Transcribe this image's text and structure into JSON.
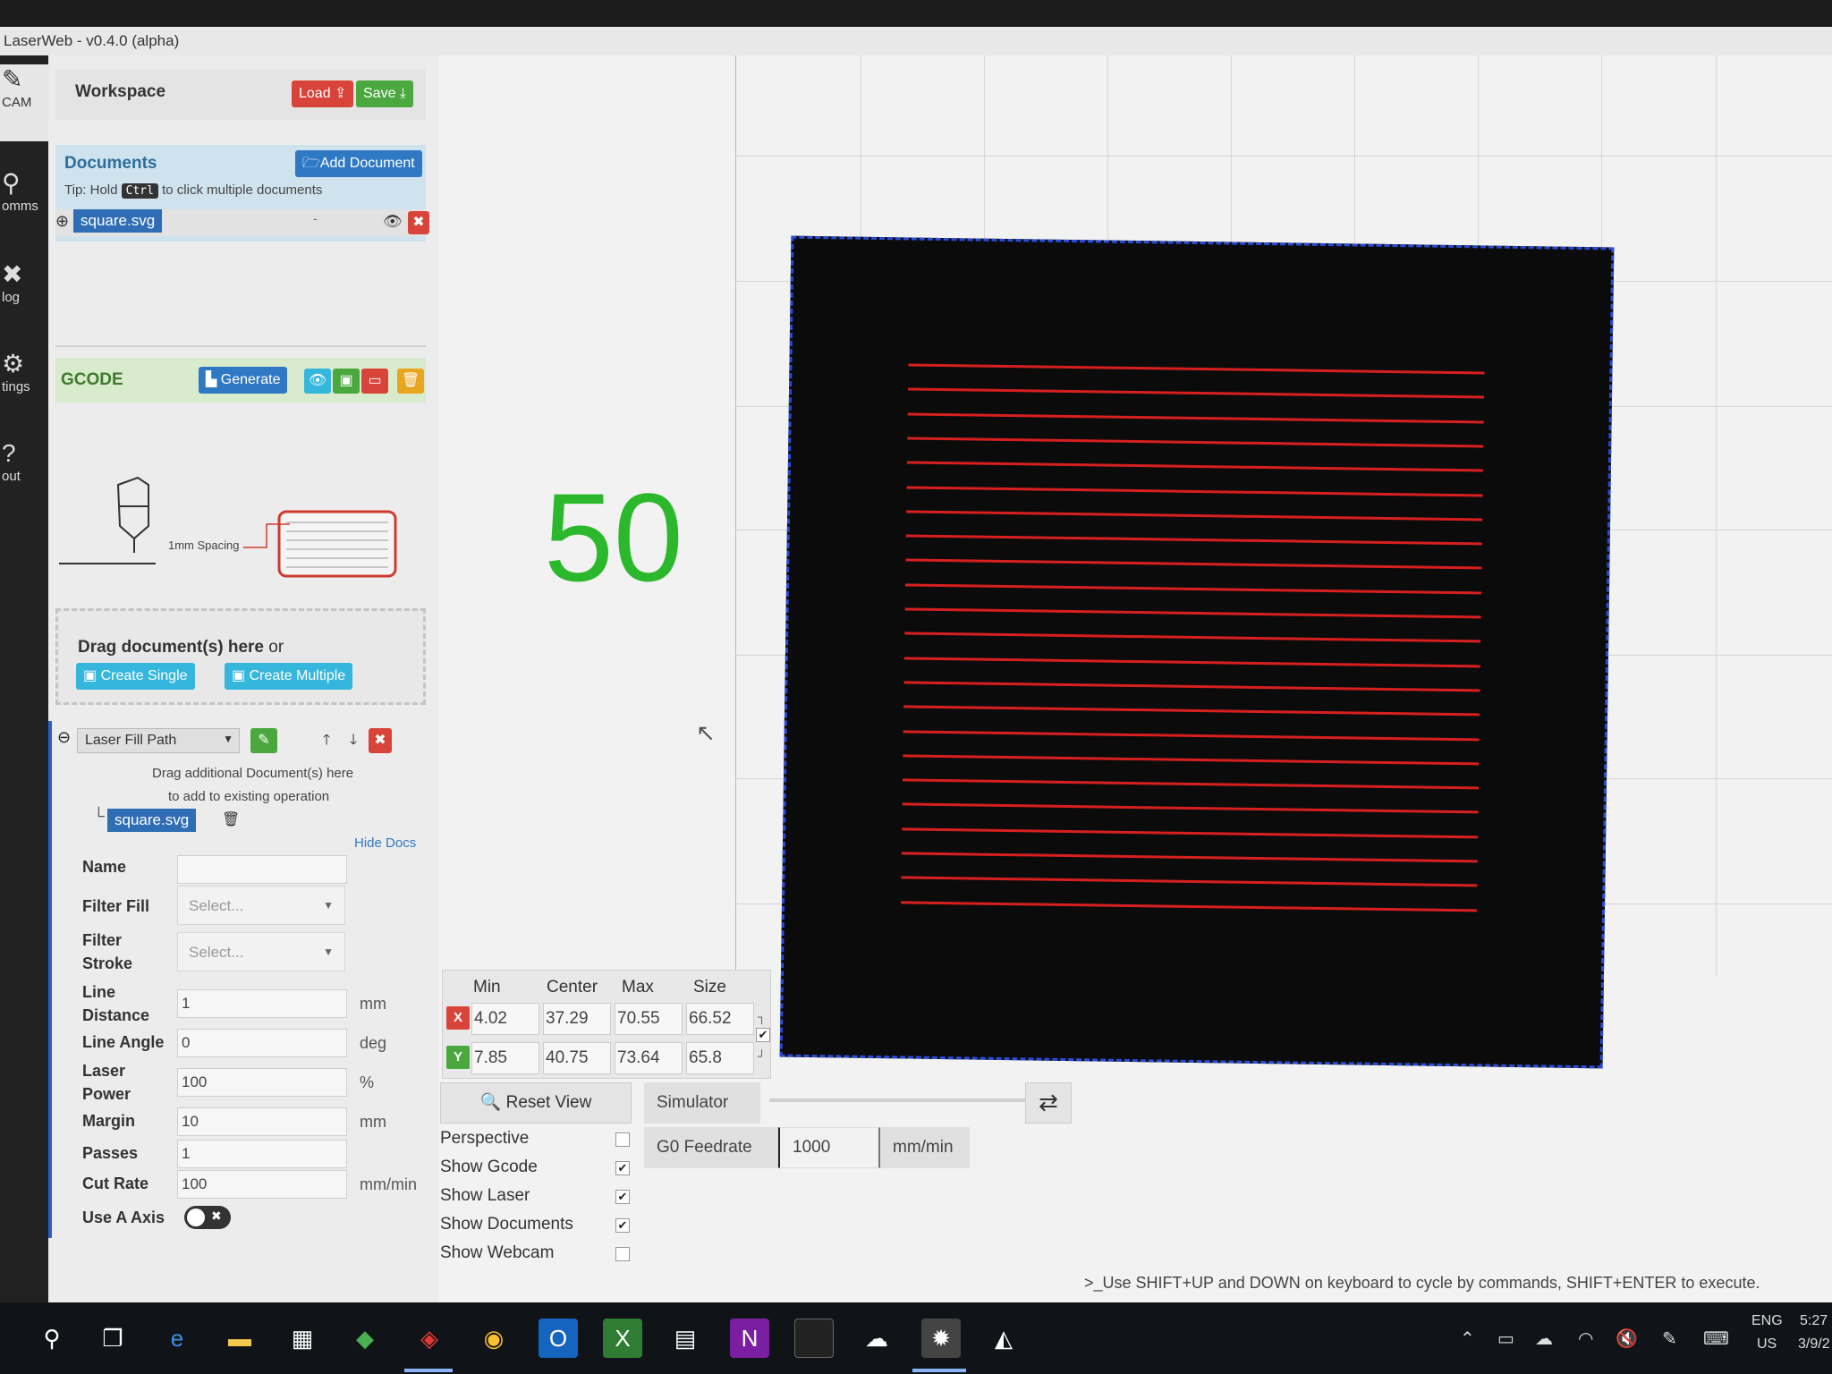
{
  "window": {
    "title": "LaserWeb - v0.4.0 (alpha)"
  },
  "rail": [
    {
      "label": "CAM",
      "icon": "edit-icon"
    },
    {
      "label": "omms",
      "icon": "plug-icon"
    },
    {
      "label": "log",
      "icon": "tools-icon"
    },
    {
      "label": "tings",
      "icon": "gears-icon"
    },
    {
      "label": "out",
      "icon": "question-icon"
    }
  ],
  "workspace": {
    "title": "Workspace",
    "load": "Load",
    "save": "Save"
  },
  "documents": {
    "title": "Documents",
    "add": "Add Document",
    "tip_prefix": "Tip: Hold",
    "tip_key": "Ctrl",
    "tip_suffix": "to click multiple documents",
    "items": [
      {
        "name": "square.svg",
        "dash": "-"
      }
    ]
  },
  "gcode": {
    "title": "GCODE",
    "generate": "Generate",
    "spacing_label": "1mm Spacing"
  },
  "dropzone": {
    "title": "Drag document(s) here",
    "or": "or",
    "create_single": "Create Single",
    "create_multiple": "Create Multiple"
  },
  "operation": {
    "type": "Laser Fill Path",
    "drag_note_1": "Drag additional Document(s) here",
    "drag_note_2": "to add to existing operation",
    "doc": "square.svg",
    "hide_docs": "Hide Docs",
    "fields": {
      "name": {
        "label": "Name",
        "value": ""
      },
      "filter_fill": {
        "label_1": "Filter Fill",
        "placeholder": "Select..."
      },
      "filter_stroke": {
        "label_1": "Filter",
        "label_2": "Stroke",
        "placeholder": "Select..."
      },
      "line_distance": {
        "label_1": "Line",
        "label_2": "Distance",
        "value": "1",
        "unit": "mm"
      },
      "line_angle": {
        "label": "Line Angle",
        "value": "0",
        "unit": "deg"
      },
      "laser_power": {
        "label_1": "Laser",
        "label_2": "Power",
        "value": "100",
        "unit": "%"
      },
      "margin": {
        "label": "Margin",
        "value": "10",
        "unit": "mm"
      },
      "passes": {
        "label": "Passes",
        "value": "1"
      },
      "cut_rate": {
        "label": "Cut Rate",
        "value": "100",
        "unit": "mm/min"
      },
      "use_a_axis": {
        "label": "Use A Axis",
        "on": false
      }
    }
  },
  "viewport": {
    "overlay_number": "50",
    "fill_lines": 23,
    "colors": {
      "fill_line": "#d81f1f",
      "selection": "#2a4cd8",
      "overlay": "#2cb82c"
    }
  },
  "coords": {
    "headers": {
      "min": "Min",
      "center": "Center",
      "max": "Max",
      "size": "Size"
    },
    "x": {
      "axis": "X",
      "min": "4.02",
      "center": "37.29",
      "max": "70.55",
      "size": "66.52"
    },
    "y": {
      "axis": "Y",
      "min": "7.85",
      "center": "40.75",
      "max": "73.64",
      "size": "65.8"
    }
  },
  "view_controls": {
    "reset_view": "Reset View",
    "simulator": "Simulator",
    "perspective": {
      "label": "Perspective",
      "checked": false
    },
    "show_gcode": {
      "label": "Show Gcode",
      "checked": true
    },
    "show_laser": {
      "label": "Show Laser",
      "checked": true
    },
    "show_documents": {
      "label": "Show Documents",
      "checked": true
    },
    "show_webcam": {
      "label": "Show Webcam",
      "checked": false
    },
    "g0_feedrate": {
      "label": "G0 Feedrate",
      "value": "1000",
      "unit": "mm/min"
    }
  },
  "console": {
    "prompt": ">_",
    "hint": "Use SHIFT+UP and DOWN on keyboard to cycle by commands, SHIFT+ENTER to execute."
  },
  "taskbar": {
    "lang_1": "ENG",
    "lang_2": "US",
    "time": "5:27",
    "date": "3/9/2"
  }
}
